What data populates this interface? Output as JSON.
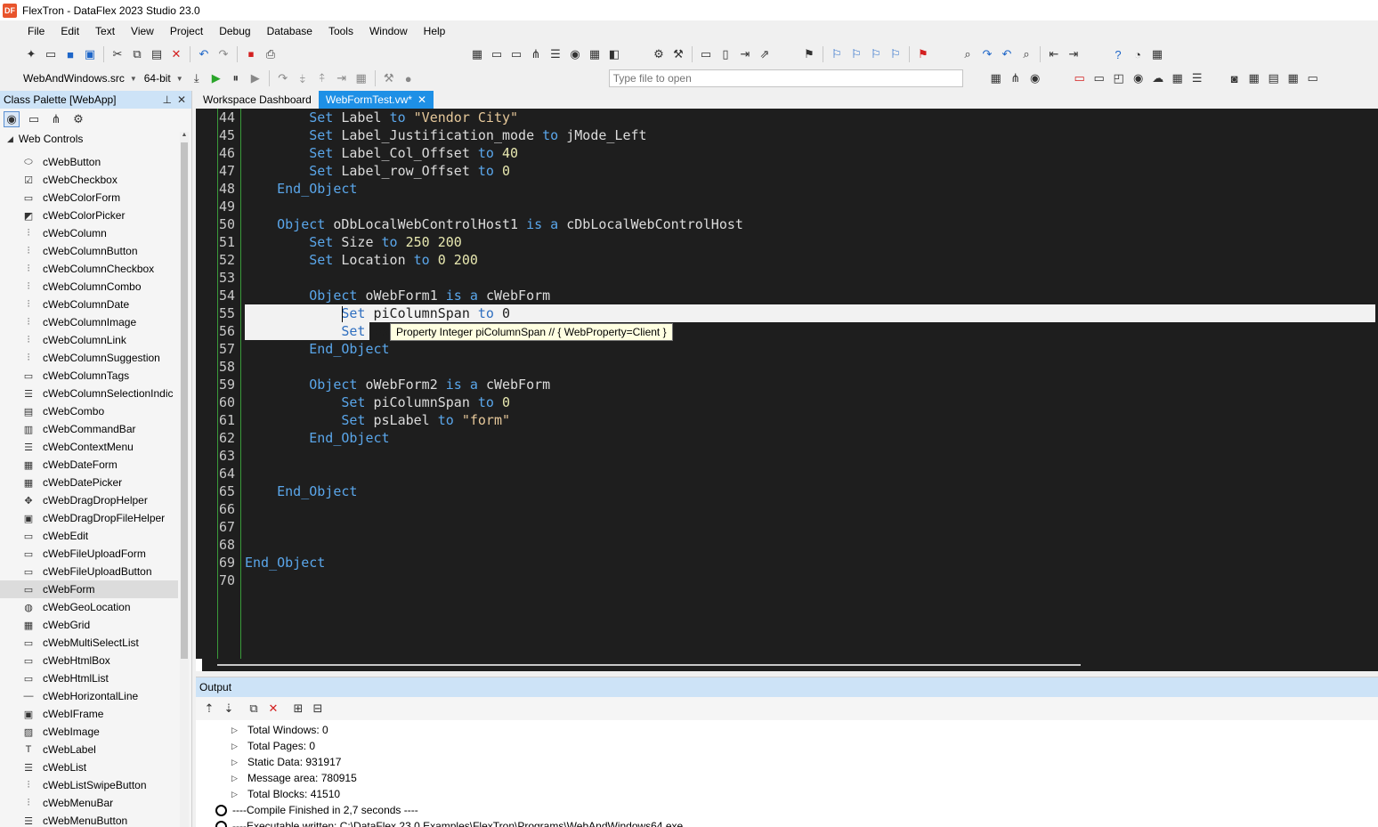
{
  "window": {
    "title": "FlexTron - DataFlex 2023 Studio 23.0",
    "icon_label": "DF"
  },
  "menu": [
    "File",
    "Edit",
    "Text",
    "View",
    "Project",
    "Debug",
    "Database",
    "Tools",
    "Window",
    "Help"
  ],
  "toolbar": {
    "project_select": "WebAndWindows.src",
    "bitness_select": "64-bit",
    "file_open_placeholder": "Type file to open"
  },
  "palette": {
    "title": "Class Palette [WebApp]",
    "category": "Web Controls",
    "items": [
      {
        "label": "cWebButton",
        "icon": "button-icon"
      },
      {
        "label": "cWebCheckbox",
        "icon": "checkbox-icon"
      },
      {
        "label": "cWebColorForm",
        "icon": "colorform-icon"
      },
      {
        "label": "cWebColorPicker",
        "icon": "colorpicker-icon"
      },
      {
        "label": "cWebColumn",
        "icon": "column-icon"
      },
      {
        "label": "cWebColumnButton",
        "icon": "column-button-icon"
      },
      {
        "label": "cWebColumnCheckbox",
        "icon": "column-checkbox-icon"
      },
      {
        "label": "cWebColumnCombo",
        "icon": "column-combo-icon"
      },
      {
        "label": "cWebColumnDate",
        "icon": "column-date-icon"
      },
      {
        "label": "cWebColumnImage",
        "icon": "column-image-icon"
      },
      {
        "label": "cWebColumnLink",
        "icon": "column-link-icon"
      },
      {
        "label": "cWebColumnSuggestion",
        "icon": "column-suggestion-icon"
      },
      {
        "label": "cWebColumnTags",
        "icon": "column-tags-icon"
      },
      {
        "label": "cWebColumnSelectionIndic",
        "icon": "column-selection-icon"
      },
      {
        "label": "cWebCombo",
        "icon": "combo-icon"
      },
      {
        "label": "cWebCommandBar",
        "icon": "commandbar-icon"
      },
      {
        "label": "cWebContextMenu",
        "icon": "contextmenu-icon"
      },
      {
        "label": "cWebDateForm",
        "icon": "dateform-icon"
      },
      {
        "label": "cWebDatePicker",
        "icon": "datepicker-icon"
      },
      {
        "label": "cWebDragDropHelper",
        "icon": "dragdrop-icon"
      },
      {
        "label": "cWebDragDropFileHelper",
        "icon": "dragdrop-file-icon"
      },
      {
        "label": "cWebEdit",
        "icon": "edit-icon"
      },
      {
        "label": "cWebFileUploadForm",
        "icon": "fileupload-form-icon"
      },
      {
        "label": "cWebFileUploadButton",
        "icon": "fileupload-button-icon"
      },
      {
        "label": "cWebForm",
        "icon": "form-icon"
      },
      {
        "label": "cWebGeoLocation",
        "icon": "geolocation-icon"
      },
      {
        "label": "cWebGrid",
        "icon": "grid-icon"
      },
      {
        "label": "cWebMultiSelectList",
        "icon": "multiselect-icon"
      },
      {
        "label": "cWebHtmlBox",
        "icon": "htmlbox-icon"
      },
      {
        "label": "cWebHtmlList",
        "icon": "htmllist-icon"
      },
      {
        "label": "cWebHorizontalLine",
        "icon": "horizontal-line-icon"
      },
      {
        "label": "cWebIFrame",
        "icon": "iframe-icon"
      },
      {
        "label": "cWebImage",
        "icon": "image-icon"
      },
      {
        "label": "cWebLabel",
        "icon": "label-icon"
      },
      {
        "label": "cWebList",
        "icon": "list-icon"
      },
      {
        "label": "cWebListSwipeButton",
        "icon": "swipe-button-icon"
      },
      {
        "label": "cWebMenuBar",
        "icon": "menubar-icon"
      },
      {
        "label": "cWebMenuButton",
        "icon": "menubutton-icon"
      }
    ],
    "selected": "cWebForm"
  },
  "tabs": [
    {
      "label": "Workspace Dashboard",
      "active": false
    },
    {
      "label": "WebFormTest.vw*",
      "active": true
    }
  ],
  "editor": {
    "line_numbers": [
      "44",
      "45",
      "46",
      "47",
      "48",
      "49",
      "50",
      "51",
      "52",
      "53",
      "54",
      "55",
      "56",
      "57",
      "58",
      "59",
      "60",
      "61",
      "62",
      "63",
      "64",
      "65",
      "66",
      "67",
      "68",
      "69",
      "70"
    ],
    "lines": [
      {
        "i": "        ",
        "t": [
          [
            "kw",
            "Set "
          ],
          [
            "id",
            "Label "
          ],
          [
            "kw",
            "to "
          ],
          [
            "str",
            "\"Vendor City\""
          ]
        ]
      },
      {
        "i": "        ",
        "t": [
          [
            "kw",
            "Set "
          ],
          [
            "id",
            "Label_Justification_mode "
          ],
          [
            "kw",
            "to "
          ],
          [
            "id",
            "jMode_Left"
          ]
        ]
      },
      {
        "i": "        ",
        "t": [
          [
            "kw",
            "Set "
          ],
          [
            "id",
            "Label_Col_Offset "
          ],
          [
            "kw",
            "to "
          ],
          [
            "num",
            "40"
          ]
        ]
      },
      {
        "i": "        ",
        "t": [
          [
            "kw",
            "Set "
          ],
          [
            "id",
            "Label_row_Offset "
          ],
          [
            "kw",
            "to "
          ],
          [
            "num",
            "0"
          ]
        ]
      },
      {
        "i": "    ",
        "t": [
          [
            "kw",
            "End_Object"
          ]
        ]
      },
      {
        "i": "",
        "t": []
      },
      {
        "i": "    ",
        "t": [
          [
            "kw",
            "Object "
          ],
          [
            "id",
            "oDbLocalWebControlHost1 "
          ],
          [
            "kw",
            "is a "
          ],
          [
            "id",
            "cDbLocalWebControlHost"
          ]
        ]
      },
      {
        "i": "        ",
        "t": [
          [
            "kw",
            "Set "
          ],
          [
            "id",
            "Size "
          ],
          [
            "kw",
            "to "
          ],
          [
            "num",
            "250 200"
          ]
        ]
      },
      {
        "i": "        ",
        "t": [
          [
            "kw",
            "Set "
          ],
          [
            "id",
            "Location "
          ],
          [
            "kw",
            "to "
          ],
          [
            "num",
            "0 200"
          ]
        ]
      },
      {
        "i": "",
        "t": []
      },
      {
        "i": "        ",
        "t": [
          [
            "kw",
            "Object "
          ],
          [
            "id",
            "oWebForm1 "
          ],
          [
            "kw",
            "is a "
          ],
          [
            "id",
            "cWebForm"
          ]
        ]
      },
      {
        "i": "            ",
        "t": [
          [
            "kw",
            "Set "
          ],
          [
            "id",
            "piColumnSpan "
          ],
          [
            "kw",
            "to "
          ],
          [
            "num",
            "0"
          ]
        ],
        "highlight": "full"
      },
      {
        "i": "            ",
        "t": [
          [
            "kw",
            "Set "
          ],
          [
            "id",
            "ps"
          ]
        ],
        "highlight": "partial"
      },
      {
        "i": "        ",
        "t": [
          [
            "kw",
            "End_Object"
          ]
        ]
      },
      {
        "i": "",
        "t": []
      },
      {
        "i": "        ",
        "t": [
          [
            "kw",
            "Object "
          ],
          [
            "id",
            "oWebForm2 "
          ],
          [
            "kw",
            "is a "
          ],
          [
            "id",
            "cWebForm"
          ]
        ]
      },
      {
        "i": "            ",
        "t": [
          [
            "kw",
            "Set "
          ],
          [
            "id",
            "piColumnSpan "
          ],
          [
            "kw",
            "to "
          ],
          [
            "num",
            "0"
          ]
        ]
      },
      {
        "i": "            ",
        "t": [
          [
            "kw",
            "Set "
          ],
          [
            "id",
            "psLabel "
          ],
          [
            "kw",
            "to "
          ],
          [
            "str",
            "\"form\""
          ]
        ]
      },
      {
        "i": "        ",
        "t": [
          [
            "kw",
            "End_Object"
          ]
        ]
      },
      {
        "i": "",
        "t": []
      },
      {
        "i": "",
        "t": []
      },
      {
        "i": "    ",
        "t": [
          [
            "kw",
            "End_Object"
          ]
        ]
      },
      {
        "i": "",
        "t": []
      },
      {
        "i": "",
        "t": []
      },
      {
        "i": "",
        "t": []
      },
      {
        "i": "",
        "t": [
          [
            "kw",
            "End_Object"
          ]
        ]
      },
      {
        "i": "",
        "t": []
      }
    ],
    "tooltip": "Property Integer piColumnSpan // { WebProperty=Client }"
  },
  "output": {
    "title": "Output",
    "stats": [
      {
        "label": "Total Windows",
        "value": ": 0"
      },
      {
        "label": "Total Pages",
        "value": ": 0"
      },
      {
        "label": "Static Data",
        "value": ": 931917"
      },
      {
        "label": "Message area",
        "value": ": 780915"
      },
      {
        "label": "Total Blocks",
        "value": ": 41510"
      }
    ],
    "messages": [
      "----Compile Finished in 2,7 seconds ----",
      "----Executable written: C:\\DataFlex 23.0 Examples\\FlexTron\\Programs\\WebAndWindows64.exe"
    ]
  }
}
